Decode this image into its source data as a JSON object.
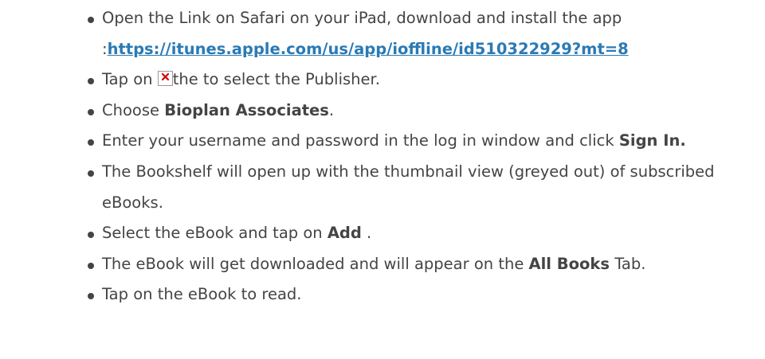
{
  "steps": [
    {
      "prefix": "Open the Link on Safari on your iPad, download and install the app",
      "link_prefix": ":",
      "link_text": "https://itunes.apple.com/us/app/ioffline/id510322929?mt=8"
    },
    {
      "before": "Tap on ",
      "icon": "broken-image-icon",
      "after": "the to select the Publisher."
    },
    {
      "before": "Choose ",
      "bold": "Bioplan Associates",
      "after": "."
    },
    {
      "before": "Enter your username and password in the log in window and click ",
      "bold": "Sign In."
    },
    {
      "text": "The Bookshelf will open up with the thumbnail view (greyed out) of subscribed eBooks."
    },
    {
      "before": "Select the eBook and tap on ",
      "bold": "Add",
      "after": " ."
    },
    {
      "before": "The eBook will get downloaded and will appear on the ",
      "bold": "All Books",
      "after": " Tab."
    },
    {
      "text": "Tap on the eBook to read."
    }
  ],
  "colors": {
    "text": "#444444",
    "link": "#2a7ab5",
    "broken_icon_x": "#d40000"
  }
}
